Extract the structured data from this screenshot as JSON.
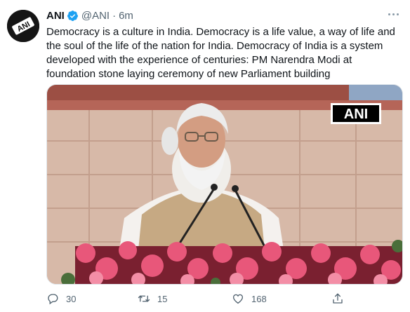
{
  "tweet": {
    "display_name": "ANI",
    "handle": "@ANI",
    "separator": "·",
    "time": "6m",
    "text": "Democracy is a culture in India. Democracy is a life value, a way of life and the soul of the life of the nation for India. Democracy of India is a system developed with the experience of centuries: PM Narendra Modi at foundation stone laying ceremony of new Parliament building",
    "avatar_text": "ANI",
    "media_watermark": "ANI",
    "replies": "30",
    "retweets": "15",
    "likes": "168"
  },
  "colors": {
    "verified": "#1da1f2",
    "secondary_text": "#536471",
    "primary_text": "#0f1419"
  },
  "icons": {
    "more": "more-icon",
    "reply": "reply-icon",
    "retweet": "retweet-icon",
    "like": "heart-icon",
    "share": "share-icon",
    "verified": "verified-badge-icon"
  }
}
